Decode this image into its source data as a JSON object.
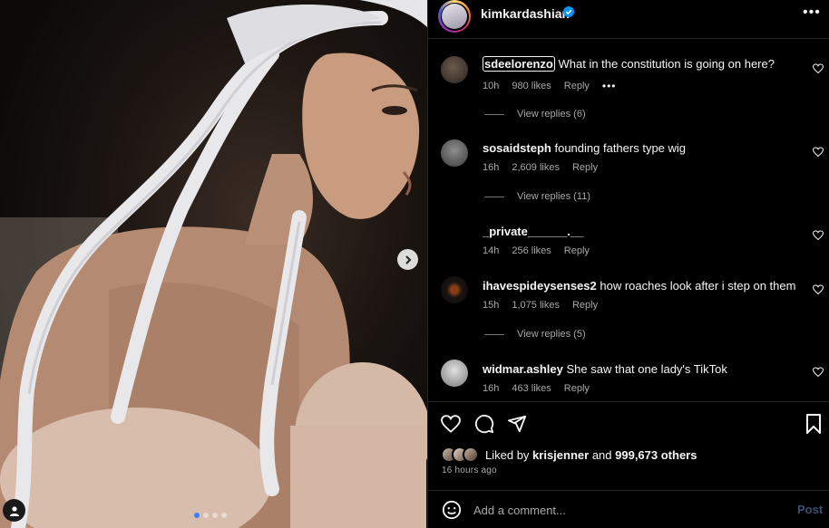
{
  "post": {
    "author": "kimkardashian",
    "verified": true,
    "carousel": {
      "current": 1,
      "total": 4
    }
  },
  "comments": [
    {
      "user": "sdeelorenzo",
      "text": "What in the constitution is going on here?",
      "time": "10h",
      "likes": "980 likes",
      "reply": "Reply",
      "replies": "View replies (6)"
    },
    {
      "user": "sosaidsteph",
      "text": "founding fathers type wig",
      "time": "16h",
      "likes": "2,609 likes",
      "reply": "Reply",
      "replies": "View replies (11)"
    },
    {
      "user": "_private______.__",
      "text": "",
      "time": "14h",
      "likes": "256 likes",
      "reply": "Reply",
      "replies": ""
    },
    {
      "user": "ihavespideysenses2",
      "text": "how roaches look after i step on them",
      "time": "15h",
      "likes": "1,075 likes",
      "reply": "Reply",
      "replies": "View replies (5)"
    },
    {
      "user": "widmar.ashley",
      "text": "She saw that one lady's TikTok",
      "time": "16h",
      "likes": "463 likes",
      "reply": "Reply",
      "replies": ""
    }
  ],
  "likes": {
    "prefix": "Liked by ",
    "user": "krisjenner",
    "middle": " and ",
    "count": "999,673 others"
  },
  "posted": "16 hours ago",
  "input": {
    "placeholder": "Add a comment..."
  },
  "post_button": "Post",
  "colors": {
    "accent": "#0095f6",
    "muted": "#a8a8a8",
    "border": "#262626"
  },
  "icons": [
    "next-arrow-icon",
    "user-tag-icon",
    "verified-badge-icon",
    "more-options-icon",
    "heart-icon",
    "comment-icon",
    "share-icon",
    "bookmark-icon",
    "emoji-icon"
  ]
}
